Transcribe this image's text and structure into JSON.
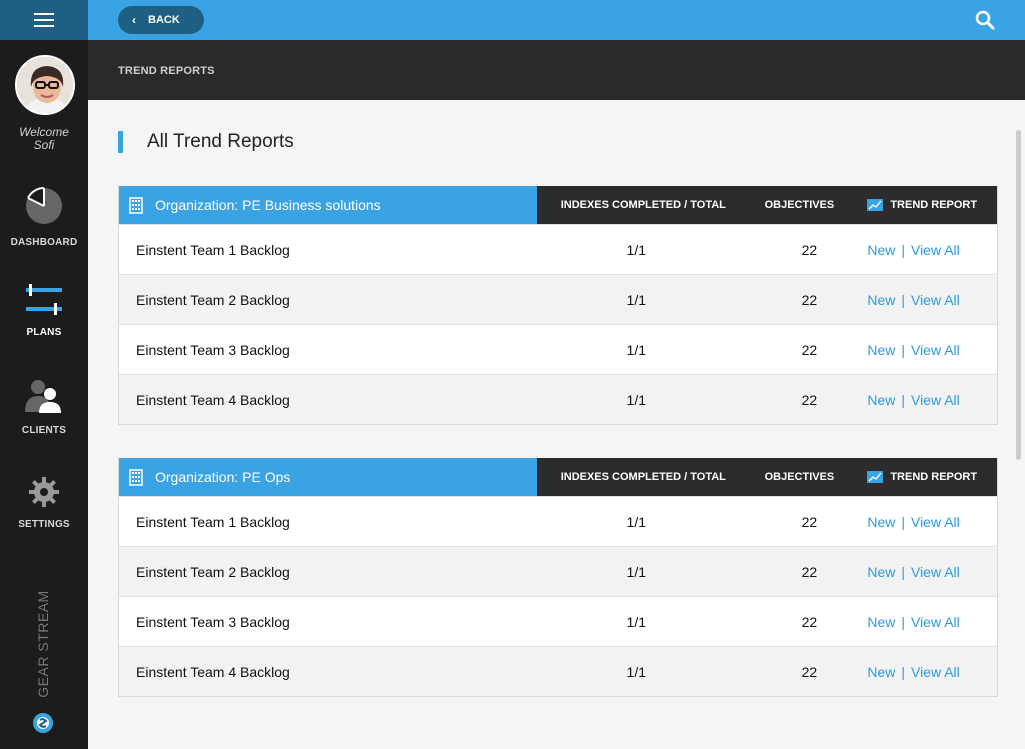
{
  "sidebar": {
    "welcome": "Welcome",
    "user_name": "Sofi",
    "nav": [
      {
        "label": "DASHBOARD",
        "icon": "dashboard-icon"
      },
      {
        "label": "PLANS",
        "icon": "plans-icon"
      },
      {
        "label": "CLIENTS",
        "icon": "clients-icon"
      },
      {
        "label": "SETTINGS",
        "icon": "gear-icon"
      }
    ],
    "brand": "GEAR STREAM"
  },
  "topbar": {
    "back_label": "BACK",
    "accent_color": "#3aa3e3"
  },
  "breadcrumb": "TREND REPORTS",
  "page_title": "All Trend Reports",
  "columns": {
    "indexes": "INDEXES COMPLETED / TOTAL",
    "objectives": "OBJECTIVES",
    "trend_report": "TREND REPORT"
  },
  "organizations": [
    {
      "name": "Organization: PE Business solutions",
      "rows": [
        {
          "name": "Einstent Team 1 Backlog",
          "indexes": "1/1",
          "objectives": "22",
          "new": "New",
          "sep": "|",
          "view_all": "View All"
        },
        {
          "name": "Einstent Team 2 Backlog",
          "indexes": "1/1",
          "objectives": "22",
          "new": "New",
          "sep": "|",
          "view_all": "View All"
        },
        {
          "name": "Einstent Team 3 Backlog",
          "indexes": "1/1",
          "objectives": "22",
          "new": "New",
          "sep": "|",
          "view_all": "View All"
        },
        {
          "name": "Einstent Team 4 Backlog",
          "indexes": "1/1",
          "objectives": "22",
          "new": "New",
          "sep": "|",
          "view_all": "View All"
        }
      ]
    },
    {
      "name": "Organization: PE Ops",
      "rows": [
        {
          "name": "Einstent Team 1 Backlog",
          "indexes": "1/1",
          "objectives": "22",
          "new": "New",
          "sep": "|",
          "view_all": "View All"
        },
        {
          "name": "Einstent Team 2 Backlog",
          "indexes": "1/1",
          "objectives": "22",
          "new": "New",
          "sep": "|",
          "view_all": "View All"
        },
        {
          "name": "Einstent Team 3 Backlog",
          "indexes": "1/1",
          "objectives": "22",
          "new": "New",
          "sep": "|",
          "view_all": "View All"
        },
        {
          "name": "Einstent Team 4 Backlog",
          "indexes": "1/1",
          "objectives": "22",
          "new": "New",
          "sep": "|",
          "view_all": "View All"
        }
      ]
    }
  ]
}
